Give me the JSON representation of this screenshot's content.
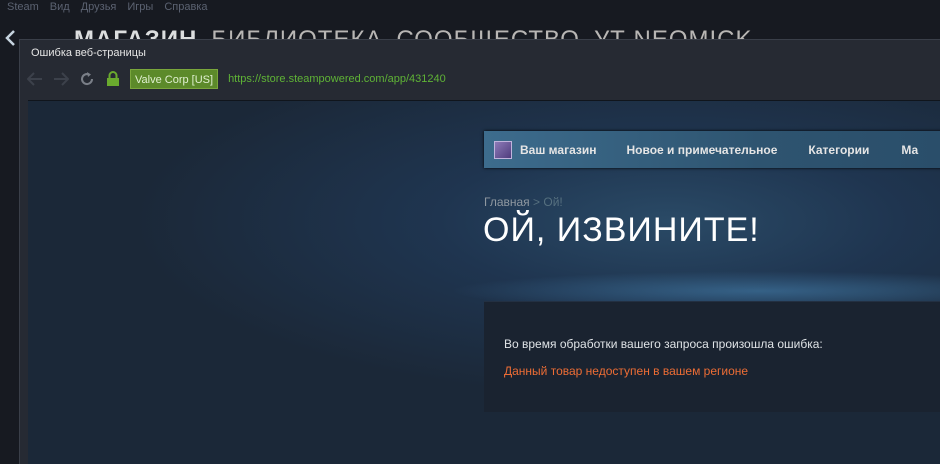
{
  "menubar": {
    "items": [
      "Steam",
      "Вид",
      "Друзья",
      "Игры",
      "Справка"
    ]
  },
  "mainnav": {
    "tabs": [
      "МАГАЗИН",
      "БИБЛИОТЕКА",
      "СООБЩЕСТВО",
      "УТ NEOMICK"
    ]
  },
  "popup": {
    "title": "Ошибка веб-страницы",
    "cert_label": "Valve Corp [US]",
    "url": "https://store.steampowered.com/app/431240"
  },
  "store": {
    "nav": [
      "Ваш магазин",
      "Новое и примечательное",
      "Категории",
      "Ма"
    ],
    "breadcrumb": {
      "home": "Главная",
      "sep": ">",
      "current": "Ой!"
    },
    "headline": "ОЙ, ИЗВИНИТЕ!",
    "error_intro": "Во время обработки вашего запроса произошла ошибка:",
    "error_detail": "Данный товар недоступен в вашем регионе"
  },
  "colors": {
    "background": "#171a21",
    "store_bg": "#1b2838",
    "nav_accent": "#3d6c8d",
    "url_green": "#5fb336",
    "cert_green": "#5c8a2a",
    "error_orange": "#ed6d35"
  },
  "icons": {
    "back": "arrow-left-icon",
    "forward": "arrow-right-icon",
    "reload": "reload-icon",
    "lock": "lock-icon"
  }
}
